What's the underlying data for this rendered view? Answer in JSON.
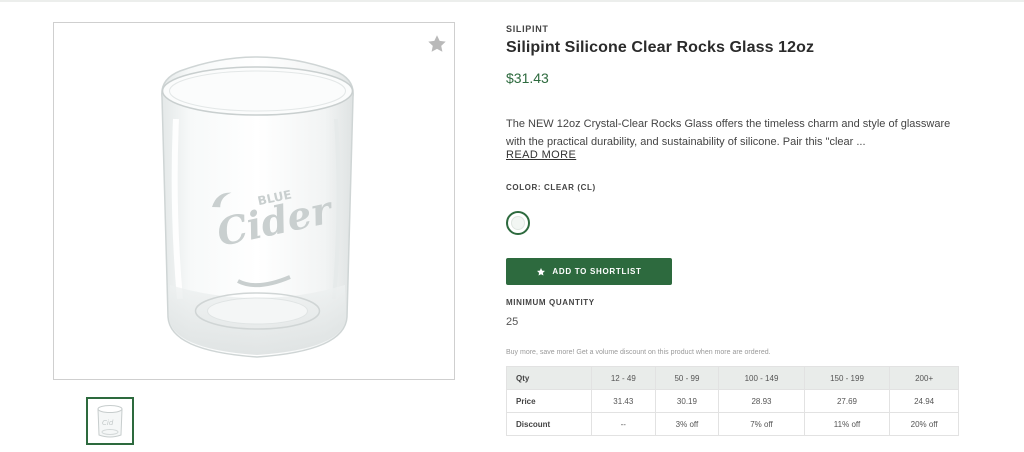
{
  "product": {
    "brand": "SILIPINT",
    "title": "Silipint Silicone Clear Rocks Glass 12oz",
    "price": "$31.43",
    "description": "The NEW 12oz Crystal-Clear Rocks Glass offers the timeless charm and style of glassware with the practical durability, and sustainability of silicone. Pair this \"clear ...",
    "read_more": "READ MORE",
    "image_logo_text": "Blue Cider"
  },
  "color": {
    "label": "COLOR: CLEAR (CL)",
    "swatch_color": "#f2f6f3"
  },
  "actions": {
    "shortlist_label": "ADD TO SHORTLIST",
    "favorite_icon": "star-icon"
  },
  "quantity": {
    "label": "MINIMUM QUANTITY",
    "value": "25"
  },
  "pricing": {
    "note": "Buy more, save more! Get a volume discount on this product when more are ordered.",
    "headers": [
      "Qty",
      "12 - 49",
      "50 - 99",
      "100 - 149",
      "150 - 199",
      "200+"
    ],
    "rows": [
      [
        "Price",
        "31.43",
        "30.19",
        "28.93",
        "27.69",
        "24.94"
      ],
      [
        "Discount",
        "--",
        "3% off",
        "7% off",
        "11% off",
        "20% off"
      ]
    ]
  },
  "theme": {
    "accent": "#2d6a3e",
    "table_header_bg": "#e9ecea"
  }
}
